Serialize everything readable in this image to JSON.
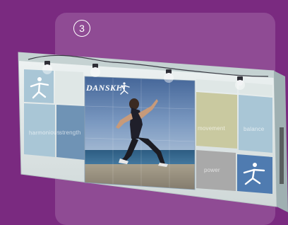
{
  "step_number": "3",
  "brand": {
    "wordmark": "DANSKIN"
  },
  "panels": {
    "harmonious": "harmonious",
    "strength": "strength",
    "movement": "movement",
    "balance": "balance",
    "power": "power"
  },
  "colors": {
    "background": "#7a2a80",
    "panel_overlay": "#8f4b94",
    "frame": "#dde6e6",
    "tile_blue": "#6f93b5",
    "tile_light_blue": "#a9c6d6",
    "tile_olive": "#c9c9a0",
    "tile_grey": "#a9a9a9",
    "photo_sky": "#5b79a3",
    "photo_sea": "#3e6f93"
  },
  "icons": [
    "dancer-logo-icon",
    "spotlight-icon"
  ]
}
